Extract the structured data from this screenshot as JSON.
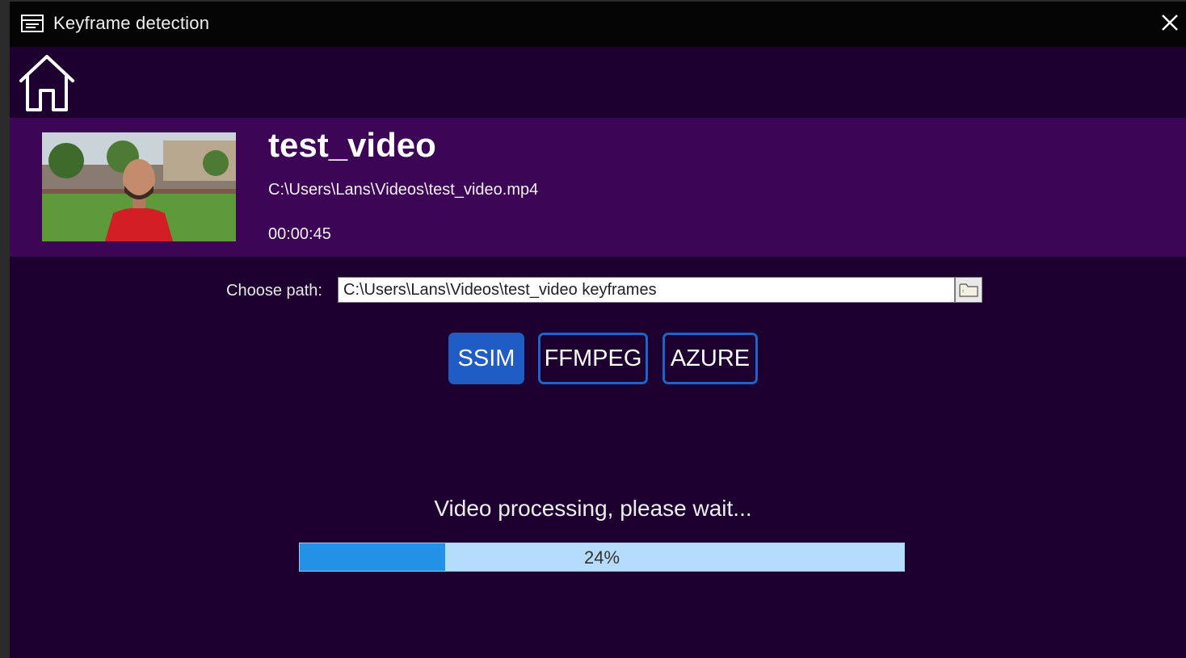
{
  "window": {
    "title": "Keyframe detection",
    "app_icon": "keyframe-app-icon",
    "close_icon": "close-icon"
  },
  "nav": {
    "home_icon": "home-icon"
  },
  "video": {
    "title": "test_video",
    "path": "C:\\Users\\Lans\\Videos\\test_video.mp4",
    "duration": "00:00:45"
  },
  "output": {
    "label": "Choose path:",
    "value": "C:\\Users\\Lans\\Videos\\test_video keyframes",
    "browse_icon": "folder-icon"
  },
  "algorithms": [
    {
      "label": "SSIM",
      "selected": true
    },
    {
      "label": "FFMPEG",
      "selected": false
    },
    {
      "label": "AZURE",
      "selected": false
    }
  ],
  "processing": {
    "status_text": "Video processing, please wait...",
    "progress_percent": 24,
    "progress_label": "24%"
  },
  "colors": {
    "background": "#1d0030",
    "card": "#3c0555",
    "accent": "#1f5cc4",
    "progress_fill": "#2291e6",
    "progress_track": "#b5dcfa"
  }
}
